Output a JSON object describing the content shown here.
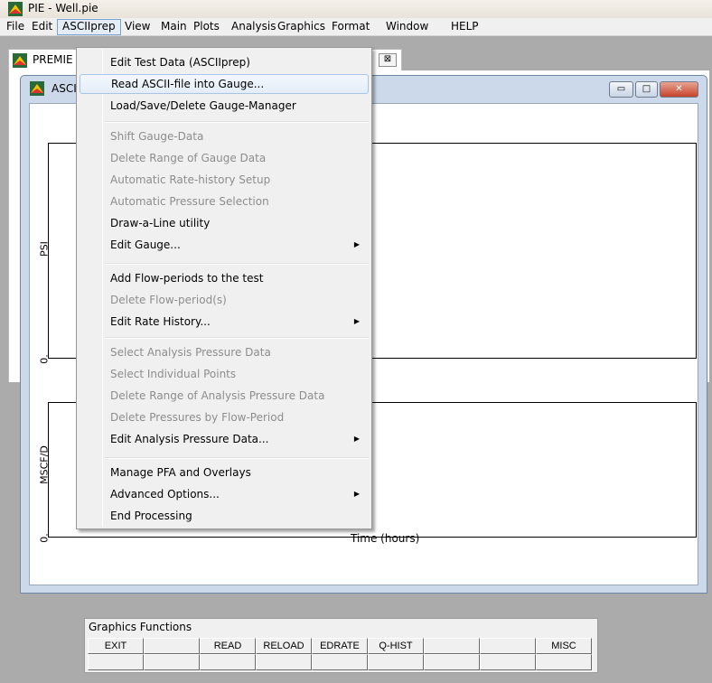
{
  "window": {
    "title": "PIE - Well.pie",
    "icon": "pie-app-icon"
  },
  "menubar": {
    "items": [
      "File",
      "Edit",
      "ASCIIprep",
      "View",
      "Main",
      "Plots",
      "Analysis",
      "Graphics",
      "Format",
      "Window",
      "HELP"
    ],
    "active": "ASCIIprep"
  },
  "doc_tab": {
    "label": "PREMIE",
    "close_glyph": "⊠"
  },
  "plot_window": {
    "title": "ASCI",
    "top_ylabel": "PSI",
    "top_tick": "0.",
    "bottom_ylabel": "MSCF/D",
    "bottom_tick": "0.",
    "xlabel": "Time (hours)",
    "minimize_glyph": "▭",
    "maximize_glyph": "□",
    "close_glyph": "✕"
  },
  "dropdown": {
    "items": [
      {
        "label": "Edit Test Data (ASCIIprep)",
        "enabled": true
      },
      {
        "label": "Read ASCII-file into Gauge...",
        "enabled": true,
        "highlight": true
      },
      {
        "label": "Load/Save/Delete Gauge-Manager",
        "enabled": true
      },
      {
        "label": "Shift Gauge-Data",
        "enabled": false
      },
      {
        "label": "Delete Range of Gauge Data",
        "enabled": false
      },
      {
        "label": "Automatic Rate-history Setup",
        "enabled": false
      },
      {
        "label": "Automatic Pressure Selection",
        "enabled": false
      },
      {
        "label": "Draw-a-Line utility",
        "enabled": true
      },
      {
        "label": "Edit Gauge...",
        "enabled": true,
        "submenu": true
      },
      {
        "label": "Add Flow-periods to the test",
        "enabled": true
      },
      {
        "label": "Delete Flow-period(s)",
        "enabled": false
      },
      {
        "label": "Edit Rate History...",
        "enabled": true,
        "submenu": true
      },
      {
        "label": "Select Analysis Pressure Data",
        "enabled": false
      },
      {
        "label": "Select Individual Points",
        "enabled": false
      },
      {
        "label": "Delete Range of Analysis Pressure Data",
        "enabled": false
      },
      {
        "label": "Delete Pressures by Flow-Period",
        "enabled": false
      },
      {
        "label": "Edit Analysis Pressure Data...",
        "enabled": true,
        "submenu": true
      },
      {
        "label": "Manage PFA and Overlays",
        "enabled": true
      },
      {
        "label": "Advanced Options...",
        "enabled": true,
        "submenu": true
      },
      {
        "label": "End Processing",
        "enabled": true
      }
    ],
    "submenu_glyph": "▶"
  },
  "graphics_functions": {
    "title": "Graphics Functions",
    "row1": [
      "EXIT",
      "",
      "READ",
      "RELOAD",
      "EDRATE",
      "Q-HIST",
      "",
      "",
      "MISC"
    ],
    "row2": [
      "",
      "",
      "",
      "",
      "",
      "",
      "",
      "",
      ""
    ]
  },
  "colors": {
    "menu_active_bg": "#e4ecf6",
    "menu_active_border": "#7da2ce",
    "disabled_text": "#8d8d8d",
    "window_frame": "#cbd9ea",
    "close_button": "#c6432c"
  }
}
